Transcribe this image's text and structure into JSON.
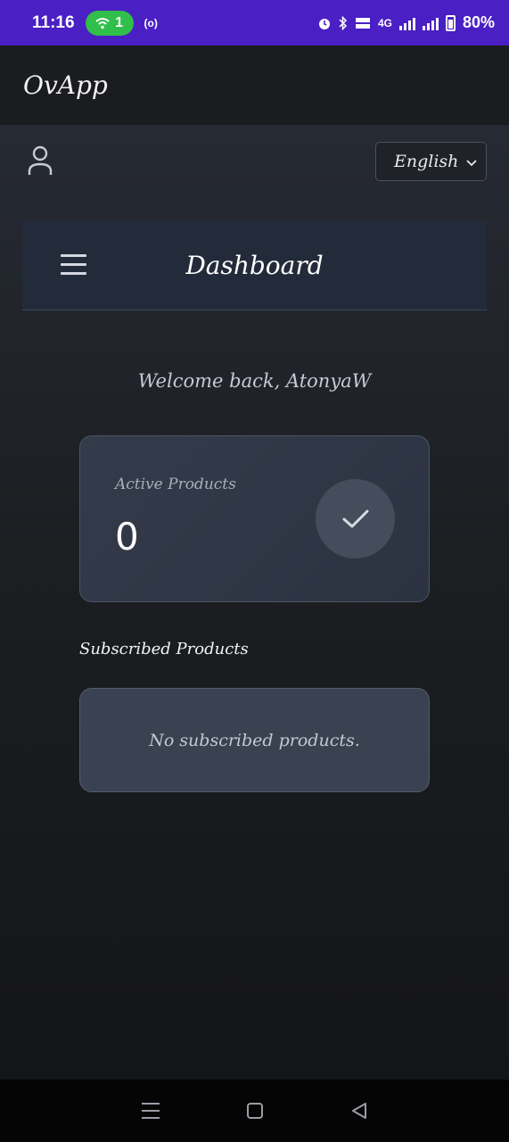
{
  "status_bar": {
    "time": "11:16",
    "hotspot_count": "1",
    "cast_label": "(o)",
    "network_label": "4G",
    "battery": "80%"
  },
  "app_bar": {
    "title": "OvApp"
  },
  "language_select": {
    "value": "English"
  },
  "dashboard": {
    "title": "Dashboard",
    "welcome": "Welcome back, AtonyaW"
  },
  "active_products": {
    "label": "Active Products",
    "count": "0"
  },
  "subscribed": {
    "heading": "Subscribed Products",
    "empty_text": "No subscribed products."
  },
  "colors": {
    "status_bar": "#4a1fc4",
    "hotspot_pill": "#2fbf4a",
    "header_bg": "#232b3a",
    "card_bg": "#343b4b"
  },
  "icons": {
    "user": "user-icon",
    "menu": "hamburger-menu-icon",
    "check": "check-icon",
    "chevron": "chevron-down-icon"
  }
}
